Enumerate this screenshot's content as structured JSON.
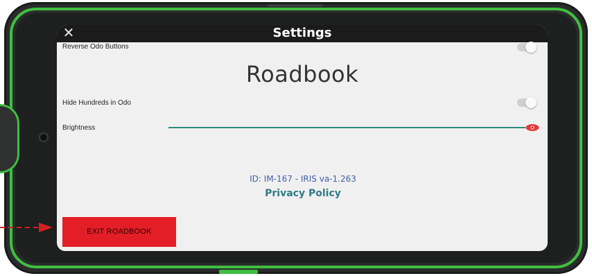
{
  "window": {
    "title": "Settings"
  },
  "settings": {
    "reverse_odo_label": "Reverse Odo Buttons",
    "reverse_odo_on": false,
    "section_heading": "Roadbook",
    "hide_hundreds_label": "Hide Hundreds in Odo",
    "hide_hundreds_on": false,
    "brightness_label": "Brightness",
    "brightness_level": 1.0
  },
  "footer": {
    "version_text": "ID: IM-167 - IRIS va-1.263",
    "privacy_link": "Privacy Policy"
  },
  "actions": {
    "exit_label": "EXIT ROADBOOK"
  },
  "colors": {
    "frame_accent": "#3fbf3f",
    "exit_button": "#e41e26",
    "slider": "#2a8a7c",
    "slider_thumb": "#e23b3b",
    "version_text": "#3f5fa8",
    "privacy_link": "#2f7b86"
  },
  "icons": {
    "close": "close-icon",
    "brightness_thumb": "eye-icon",
    "annotation": "arrow-right-icon"
  }
}
